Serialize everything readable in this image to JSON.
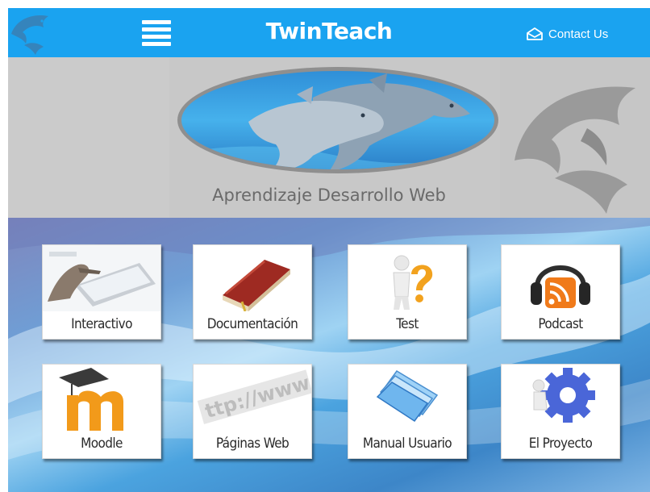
{
  "header": {
    "title": "TwinTeach",
    "contact_label": "Contact Us",
    "color": "#1aa3f0"
  },
  "banner": {
    "tagline": "Aprendizaje Desarrollo Web"
  },
  "tiles": [
    {
      "label": "Interactivo",
      "icon": "tablet-hand-icon"
    },
    {
      "label": "Documentación",
      "icon": "book-icon"
    },
    {
      "label": "Test",
      "icon": "question-figure-icon"
    },
    {
      "label": "Podcast",
      "icon": "headphones-rss-icon"
    },
    {
      "label": "Moodle",
      "icon": "moodle-logo-icon"
    },
    {
      "label": "Páginas Web",
      "icon": "http-www-icon"
    },
    {
      "label": "Manual Usuario",
      "icon": "folder-icon"
    },
    {
      "label": "El Proyecto",
      "icon": "gear-figure-icon"
    }
  ]
}
